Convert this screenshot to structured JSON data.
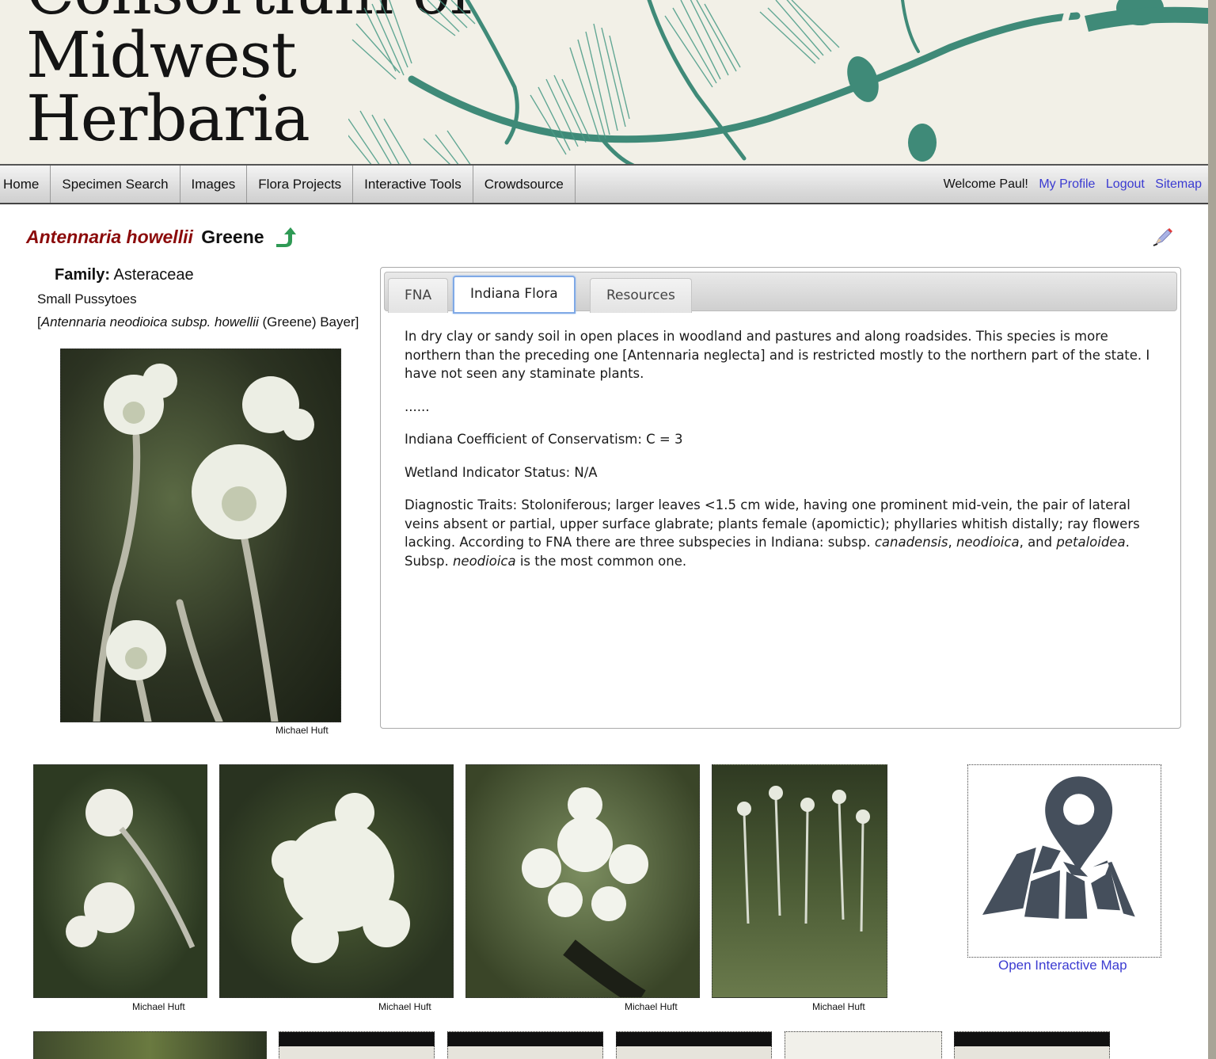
{
  "banner": {
    "title_line0": "Consortium of",
    "title_line1": "Midwest",
    "title_line2": "Herbaria"
  },
  "nav": {
    "items": [
      {
        "label": "Home"
      },
      {
        "label": "Specimen Search"
      },
      {
        "label": "Images"
      },
      {
        "label": "Flora Projects"
      },
      {
        "label": "Interactive Tools"
      },
      {
        "label": "Crowdsource"
      }
    ],
    "welcome": "Welcome Paul!",
    "my_profile": "My Profile",
    "logout": "Logout",
    "sitemap": "Sitemap"
  },
  "taxon": {
    "scientific_name": "Antennaria howellii",
    "author": "Greene",
    "family_label": "Family:",
    "family": "Asteraceae",
    "vernacular": "Small Pussytoes",
    "synonym_open": "[",
    "synonym_name": "Antennaria neodioica subsp. howellii",
    "synonym_author": " (Greene) Bayer]",
    "icons": {
      "return": "return-arrow-icon",
      "edit": "pencil-icon"
    }
  },
  "main_image": {
    "caption": "Michael Huft"
  },
  "tabs": {
    "items": [
      {
        "label": "FNA"
      },
      {
        "label": "Indiana Flora"
      },
      {
        "label": "Resources"
      }
    ],
    "active": "Indiana Flora",
    "content": {
      "para1": "In dry clay or sandy soil in open places in woodland and pastures and along roadsides. This species is more northern than the preceding one [Antennaria neglecta] and is restricted mostly to the northern part of the state. I have not seen any staminate plants.",
      "ellipsis": "......",
      "coefficient": "Indiana Coefficient of Conservatism: C = 3",
      "wetland": "Wetland Indicator Status: N/A",
      "diag_text": "Diagnostic Traits: Stoloniferous; larger leaves <1.5 cm wide, having one prominent  mid-vein, the pair of lateral veins absent or partial, upper surface glabrate; plants female (apomictic); phyllaries whitish distally; ray flowers lacking. According to FNA there are three subspecies in Indiana: subsp. ",
      "diag_i1": "canadensis",
      "diag_s1": ", ",
      "diag_i2": "neodioica",
      "diag_s2": ", and ",
      "diag_i3": "petaloidea",
      "diag_s3": ". Subsp. ",
      "diag_i4": "neodioica",
      "diag_s4": " is the most common one."
    }
  },
  "thumbnails": [
    {
      "caption": "Michael Huft"
    },
    {
      "caption": "Michael Huft"
    },
    {
      "caption": "Michael Huft"
    },
    {
      "caption": "Michael Huft"
    }
  ],
  "map": {
    "link_label": "Open Interactive Map",
    "icon": "map-pin-icon"
  }
}
